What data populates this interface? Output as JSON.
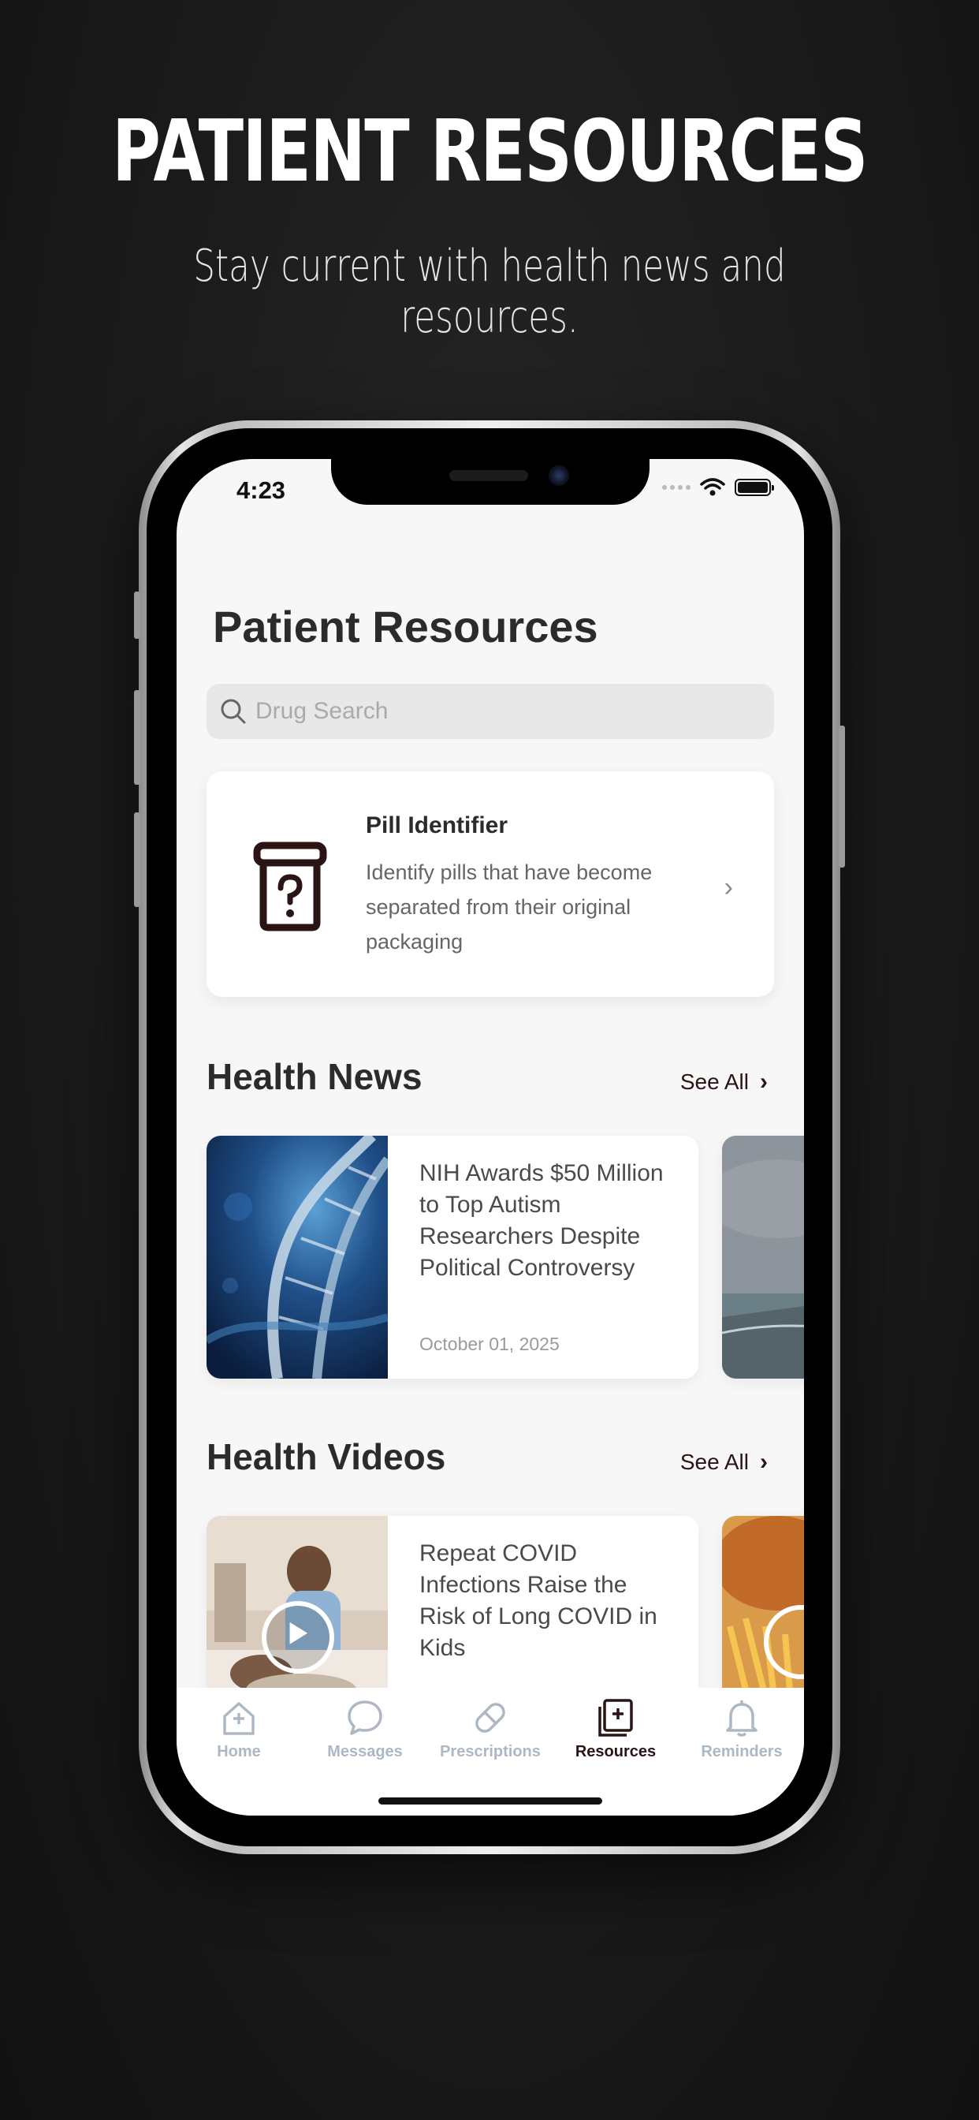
{
  "promo": {
    "headline": "PATIENT RESOURCES",
    "subheadline": "Stay current with health news and resources."
  },
  "status_bar": {
    "time": "4:23"
  },
  "screen": {
    "title": "Patient Resources",
    "search": {
      "placeholder": "Drug Search"
    },
    "pill_identifier": {
      "title": "Pill Identifier",
      "description": "Identify pills that have become separated from their original packaging"
    },
    "health_news": {
      "title": "Health News",
      "see_all": "See All",
      "items": [
        {
          "title": "NIH Awards $50 Million to Top Autism Researchers Despite Political Controversy",
          "date": "October 01, 2025"
        }
      ]
    },
    "health_videos": {
      "title": "Health Videos",
      "see_all": "See All",
      "items": [
        {
          "title": "Repeat COVID Infections Raise the Risk of Long COVID in Kids"
        }
      ]
    }
  },
  "tab_bar": {
    "items": [
      {
        "label": "Home",
        "icon": "home-plus-icon"
      },
      {
        "label": "Messages",
        "icon": "chat-bubble-icon"
      },
      {
        "label": "Prescriptions",
        "icon": "pill-icon"
      },
      {
        "label": "Resources",
        "icon": "book-plus-icon",
        "active": true
      },
      {
        "label": "Reminders",
        "icon": "bell-icon"
      }
    ],
    "active_color": "#2a1414",
    "inactive_color": "#aeb8c4"
  }
}
